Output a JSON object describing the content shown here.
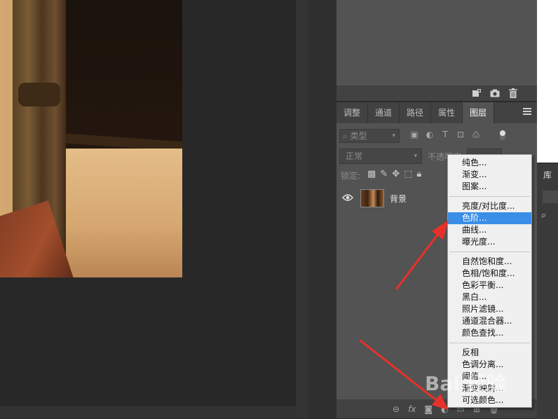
{
  "panel_tabs": [
    "调整",
    "通道",
    "路径",
    "属性",
    "图层"
  ],
  "active_tab_index": 4,
  "right_dock": {
    "tab_label": "库"
  },
  "filter": {
    "label": "类型"
  },
  "blend": {
    "mode": "正常",
    "opacity_label": "不透明度:"
  },
  "lock": {
    "label": "锁定:"
  },
  "layer": {
    "name": "背景"
  },
  "bottom_bar": {
    "fx_label": "fx"
  },
  "menu": {
    "groups": [
      [
        "纯色...",
        "渐变...",
        "图案..."
      ],
      [
        "亮度/对比度...",
        "色阶...",
        "曲线...",
        "曝光度..."
      ],
      [
        "自然饱和度...",
        "色相/饱和度...",
        "色彩平衡...",
        "黑白...",
        "照片滤镜...",
        "通道混合器...",
        "颜色查找..."
      ],
      [
        "反相",
        "色调分离...",
        "阈值...",
        "渐变映射...",
        "可选颜色..."
      ]
    ],
    "selected": "色阶..."
  },
  "watermark": "Bai 经验",
  "colors": {
    "highlight": "#3a8ee6",
    "arrow": "#e8302a",
    "panel": "#535353",
    "panel_dark": "#424242"
  },
  "icons": [
    "new-layer-icon",
    "camera-icon",
    "trash-icon",
    "panel-menu-icon",
    "search-icon",
    "eye-icon",
    "link-icon",
    "adjustment-layer-icon"
  ]
}
